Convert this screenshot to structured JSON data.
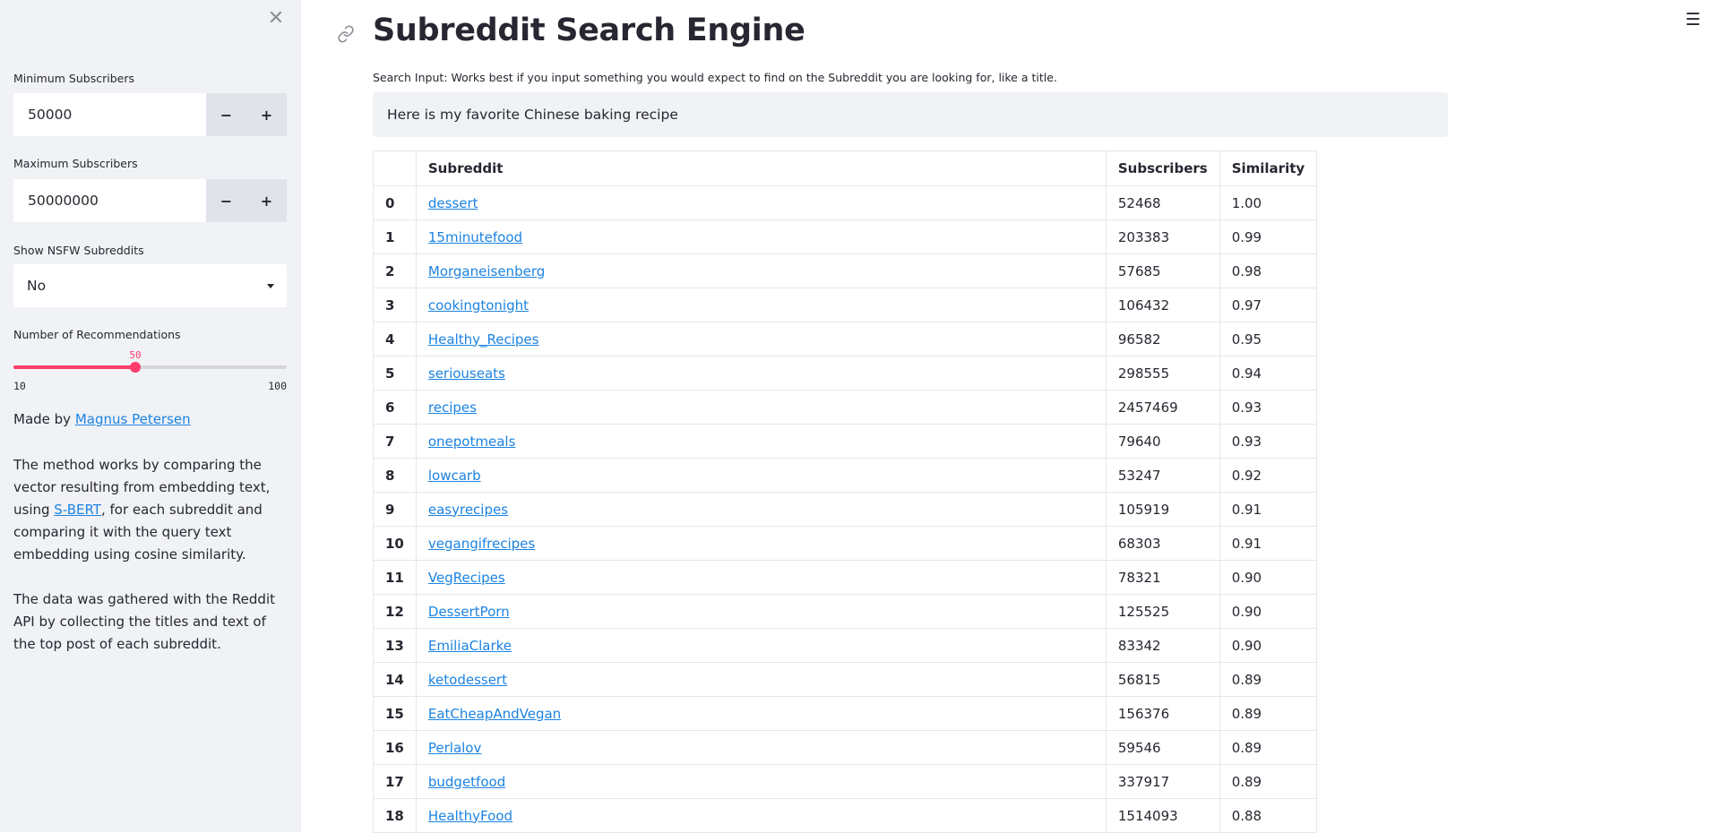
{
  "sidebar": {
    "close_icon": "close-icon",
    "min_subscribers": {
      "label": "Minimum Subscribers",
      "value": "50000",
      "decrement": "−",
      "increment": "+"
    },
    "max_subscribers": {
      "label": "Maximum Subscribers",
      "value": "50000000",
      "decrement": "−",
      "increment": "+"
    },
    "nsfw": {
      "label": "Show NSFW Subreddits",
      "selected": "No"
    },
    "recommendations": {
      "label": "Number of Recommendations",
      "value": 50,
      "min": 10,
      "max": 100,
      "value_text": "50",
      "min_text": "10",
      "max_text": "100"
    },
    "made_by_prefix": "Made by ",
    "made_by_link": "Magnus Petersen",
    "method_text_1": "The method works by comparing the vector resulting from embedding text, using ",
    "method_link": "S-BERT",
    "method_text_2": ", for each subreddit and comparing it with the query text embedding using cosine similarity.",
    "data_text": "The data was gathered with the Reddit API by collecting the titles and text of the top post of each subreddit."
  },
  "main": {
    "title": "Subreddit Search Engine",
    "search_label": "Search Input: Works best if you input something you would expect to find on the Subreddit you are looking for, like a title.",
    "search_value": "Here is my favorite Chinese baking recipe",
    "menu_icon": "hamburger-icon",
    "anchor_icon": "link-icon"
  },
  "table": {
    "headers": [
      "",
      "Subreddit",
      "Subscribers",
      "Similarity"
    ],
    "rows": [
      {
        "index": "0",
        "subreddit": "dessert",
        "subscribers": "52468",
        "similarity": "1.00"
      },
      {
        "index": "1",
        "subreddit": "15minutefood",
        "subscribers": "203383",
        "similarity": "0.99"
      },
      {
        "index": "2",
        "subreddit": "Morganeisenberg",
        "subscribers": "57685",
        "similarity": "0.98"
      },
      {
        "index": "3",
        "subreddit": "cookingtonight",
        "subscribers": "106432",
        "similarity": "0.97"
      },
      {
        "index": "4",
        "subreddit": "Healthy_Recipes",
        "subscribers": "96582",
        "similarity": "0.95"
      },
      {
        "index": "5",
        "subreddit": "seriouseats",
        "subscribers": "298555",
        "similarity": "0.94"
      },
      {
        "index": "6",
        "subreddit": "recipes",
        "subscribers": "2457469",
        "similarity": "0.93"
      },
      {
        "index": "7",
        "subreddit": "onepotmeals",
        "subscribers": "79640",
        "similarity": "0.93"
      },
      {
        "index": "8",
        "subreddit": "lowcarb",
        "subscribers": "53247",
        "similarity": "0.92"
      },
      {
        "index": "9",
        "subreddit": "easyrecipes",
        "subscribers": "105919",
        "similarity": "0.91"
      },
      {
        "index": "10",
        "subreddit": "vegangifrecipes",
        "subscribers": "68303",
        "similarity": "0.91"
      },
      {
        "index": "11",
        "subreddit": "VegRecipes",
        "subscribers": "78321",
        "similarity": "0.90"
      },
      {
        "index": "12",
        "subreddit": "DessertPorn",
        "subscribers": "125525",
        "similarity": "0.90"
      },
      {
        "index": "13",
        "subreddit": "EmiliaClarke",
        "subscribers": "83342",
        "similarity": "0.90"
      },
      {
        "index": "14",
        "subreddit": "ketodessert",
        "subscribers": "56815",
        "similarity": "0.89"
      },
      {
        "index": "15",
        "subreddit": "EatCheapAndVegan",
        "subscribers": "156376",
        "similarity": "0.89"
      },
      {
        "index": "16",
        "subreddit": "Perlalov",
        "subscribers": "59546",
        "similarity": "0.89"
      },
      {
        "index": "17",
        "subreddit": "budgetfood",
        "subscribers": "337917",
        "similarity": "0.89"
      },
      {
        "index": "18",
        "subreddit": "HealthyFood",
        "subscribers": "1514093",
        "similarity": "0.88"
      }
    ]
  },
  "colors": {
    "accent": "#ff3c6e",
    "link": "#1c83e1",
    "sidebar_bg": "#f0f2f6"
  }
}
